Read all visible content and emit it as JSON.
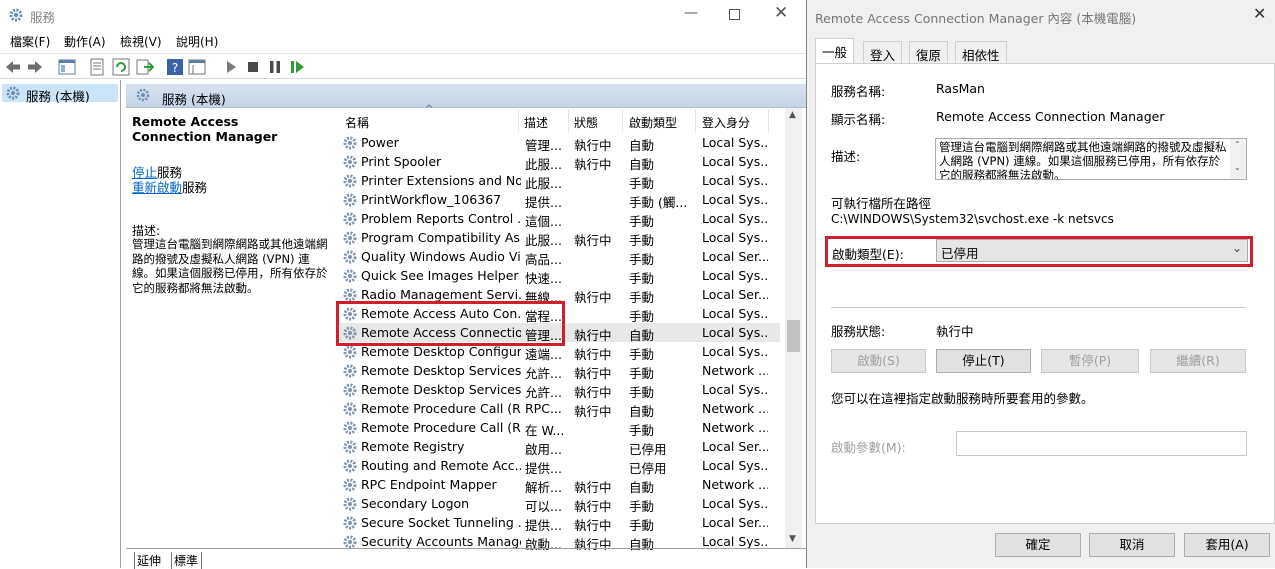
{
  "services_window": {
    "title": "服務",
    "menu": [
      "檔案(F)",
      "動作(A)",
      "檢視(V)",
      "說明(H)"
    ],
    "tree_item": "服務 (本機)",
    "header": "服務 (本機)",
    "selected_service_title": "Remote Access Connection Manager",
    "stop_link": "停止",
    "stop_suffix": "服務",
    "restart_link": "重新啟動",
    "restart_suffix": "服務",
    "description_label": "描述:",
    "description_text": "管理這台電腦到網際網路或其他遠端網路的撥號及虛擬私人網路 (VPN) 連線。如果這個服務已停用，所有依存於它的服務都將無法啟動。",
    "columns": [
      "名稱",
      "描述",
      "狀態",
      "啟動類型",
      "登入身分"
    ],
    "rows": [
      {
        "name": "Power",
        "desc": "管理...",
        "status": "執行中",
        "start": "自動",
        "logon": "Local Sys..."
      },
      {
        "name": "Print Spooler",
        "desc": "此服...",
        "status": "執行中",
        "start": "自動",
        "logon": "Local Sys..."
      },
      {
        "name": "Printer Extensions and No...",
        "desc": "此服...",
        "status": "",
        "start": "手動",
        "logon": "Local Sys..."
      },
      {
        "name": "PrintWorkflow_106367",
        "desc": "提供...",
        "status": "",
        "start": "手動 (觸...",
        "logon": "Local Sys..."
      },
      {
        "name": "Problem Reports Control ...",
        "desc": "這個...",
        "status": "",
        "start": "手動",
        "logon": "Local Sys..."
      },
      {
        "name": "Program Compatibility As...",
        "desc": "此服...",
        "status": "執行中",
        "start": "手動",
        "logon": "Local Sys..."
      },
      {
        "name": "Quality Windows Audio Vi...",
        "desc": "高品...",
        "status": "",
        "start": "手動",
        "logon": "Local Ser..."
      },
      {
        "name": "Quick See Images Helper ...",
        "desc": "快速...",
        "status": "",
        "start": "手動",
        "logon": "Local Sys..."
      },
      {
        "name": "Radio Management Servi...",
        "desc": "無線...",
        "status": "執行中",
        "start": "手動",
        "logon": "Local Ser..."
      },
      {
        "name": "Remote Access Auto Con...",
        "desc": "當程...",
        "status": "",
        "start": "手動",
        "logon": "Local Sys..."
      },
      {
        "name": "Remote Access Connectio...",
        "desc": "管理...",
        "status": "執行中",
        "start": "自動",
        "logon": "Local Sys..."
      },
      {
        "name": "Remote Desktop Configur...",
        "desc": "遠端...",
        "status": "執行中",
        "start": "手動",
        "logon": "Local Sys..."
      },
      {
        "name": "Remote Desktop Services",
        "desc": "允許...",
        "status": "執行中",
        "start": "手動",
        "logon": "Network ..."
      },
      {
        "name": "Remote Desktop Services ...",
        "desc": "允許...",
        "status": "執行中",
        "start": "手動",
        "logon": "Local Sys..."
      },
      {
        "name": "Remote Procedure Call (R...",
        "desc": "RPC...",
        "status": "執行中",
        "start": "自動",
        "logon": "Network ..."
      },
      {
        "name": "Remote Procedure Call (R...",
        "desc": "在 W...",
        "status": "",
        "start": "手動",
        "logon": "Network ..."
      },
      {
        "name": "Remote Registry",
        "desc": "啟用...",
        "status": "",
        "start": "已停用",
        "logon": "Local Ser..."
      },
      {
        "name": "Routing and Remote Acc...",
        "desc": "提供...",
        "status": "",
        "start": "已停用",
        "logon": "Local Sys..."
      },
      {
        "name": "RPC Endpoint Mapper",
        "desc": "解析...",
        "status": "執行中",
        "start": "自動",
        "logon": "Network ..."
      },
      {
        "name": "Secondary Logon",
        "desc": "可以...",
        "status": "執行中",
        "start": "手動",
        "logon": "Local Sys..."
      },
      {
        "name": "Secure Socket Tunneling ...",
        "desc": "提供...",
        "status": "執行中",
        "start": "手動",
        "logon": "Local Ser..."
      },
      {
        "name": "Security Accounts Manager",
        "desc": "啟動...",
        "status": "執行中",
        "start": "自動",
        "logon": "Local Sys..."
      }
    ],
    "bottom_tabs": [
      "延伸",
      "標準"
    ]
  },
  "dialog": {
    "title": "Remote Access Connection Manager 內容 (本機電腦)",
    "tabs": [
      "一般",
      "登入",
      "復原",
      "相依性"
    ],
    "service_name_label": "服務名稱:",
    "service_name_value": "RasMan",
    "display_name_label": "顯示名稱:",
    "display_name_value": "Remote Access Connection Manager",
    "description_label": "描述:",
    "description_value": "管理這台電腦到網際網路或其他遠端網路的撥號及虛擬私人網路 (VPN) 連線。如果這個服務已停用，所有依存於它的服務都將無法啟動。",
    "exe_path_label": "可執行檔所在路徑",
    "exe_path_value": "C:\\WINDOWS\\System32\\svchost.exe -k netsvcs",
    "startup_type_label": "啟動類型(E):",
    "startup_type_value": "已停用",
    "service_status_label": "服務狀態:",
    "service_status_value": "執行中",
    "buttons": {
      "start": "啟動(S)",
      "stop": "停止(T)",
      "pause": "暫停(P)",
      "resume": "繼續(R)"
    },
    "params_hint": "您可以在這裡指定啟動服務時所要套用的參數。",
    "start_params_label": "啟動參數(M):",
    "start_params_value": "",
    "footer": {
      "ok": "確定",
      "cancel": "取消",
      "apply": "套用(A)"
    }
  },
  "colors": {
    "highlight": "#d01e2a",
    "header_blue": "#c5d3e5",
    "link": "#0066cc"
  },
  "icons": [
    "gear-icon",
    "back-arrow-icon",
    "forward-arrow-icon",
    "play-icon",
    "stop-icon",
    "pause-icon",
    "restart-icon",
    "help-icon",
    "close-icon",
    "minimize-icon",
    "maximize-icon"
  ]
}
